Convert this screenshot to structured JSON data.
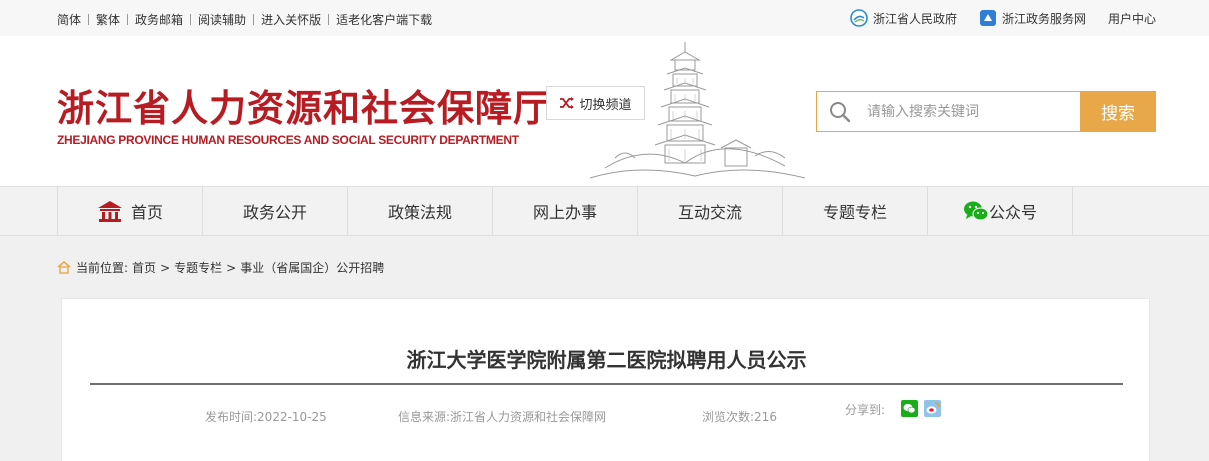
{
  "topbar": {
    "links": [
      "简体",
      "繁体",
      "政务邮箱",
      "阅读辅助",
      "进入关怀版",
      "适老化客户端下载"
    ],
    "right": {
      "gov_label": "浙江省人民政府",
      "service_label": "浙江政务服务网",
      "user_center": "用户中心"
    }
  },
  "header": {
    "title_cn": "浙江省人力资源和社会保障厅",
    "title_en": "ZHEJIANG PROVINCE HUMAN RESOURCES AND SOCIAL SECURITY DEPARTMENT",
    "switch_label": "切换频道",
    "search": {
      "placeholder": "请输入搜索关键词",
      "button": "搜索"
    }
  },
  "nav": {
    "items": [
      "首页",
      "政务公开",
      "政策法规",
      "网上办事",
      "互动交流",
      "专题专栏",
      "公众号"
    ]
  },
  "breadcrumb": {
    "label": "当前位置:",
    "items": [
      "首页",
      "专题专栏",
      "事业（省属国企）公开招聘"
    ],
    "separator": ">"
  },
  "article": {
    "title": "浙江大学医学院附属第二医院拟聘用人员公示",
    "publish_time": "发布时间:2022-10-25",
    "source": "信息来源:浙江省人力资源和社会保障网",
    "views": "浏览次数:216",
    "share_label": "分享到:"
  },
  "colors": {
    "brand_red": "#b81c23",
    "search_orange": "#e8a84a",
    "wechat_green": "#1aad19"
  },
  "icons": [
    "zhejiang-gov-icon",
    "gov-service-icon",
    "shuffle-icon",
    "search-icon",
    "home-icon",
    "wechat-icon",
    "breadcrumb-home-icon",
    "weibo-icon"
  ]
}
